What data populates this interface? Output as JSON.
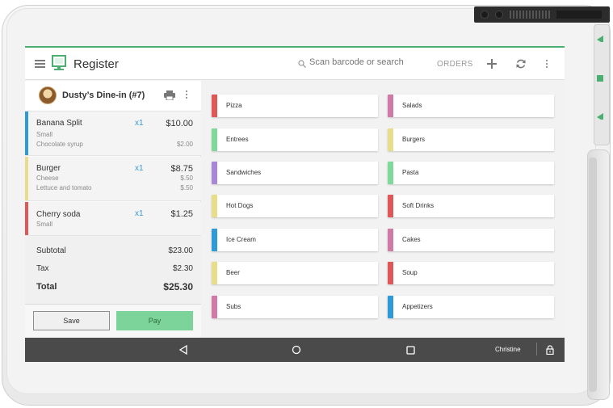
{
  "app": {
    "title": "Register",
    "search_placeholder": "Scan barcode or search",
    "orders_label": "ORDERS",
    "accent_color": "#4caf72"
  },
  "order": {
    "name": "Dusty’s Dine-in (#7)",
    "items": [
      {
        "name": "Banana Split",
        "qty": "x1",
        "price": "$10.00",
        "color": "#2f9bd6",
        "modifiers": [
          {
            "name": "Small",
            "price": ""
          },
          {
            "name": "Chocolate syrup",
            "price": "$2.00"
          }
        ]
      },
      {
        "name": "Burger",
        "qty": "x1",
        "price": "$8.75",
        "color": "#e8dd8a",
        "modifiers": [
          {
            "name": "Cheese",
            "price": "$.50"
          },
          {
            "name": "Lettuce and tomato",
            "price": "$.50"
          }
        ]
      },
      {
        "name": "Cherry soda",
        "qty": "x1",
        "price": "$1.25",
        "color": "#e05757",
        "modifiers": [
          {
            "name": "Small",
            "price": ""
          }
        ]
      }
    ],
    "subtotal_label": "Subtotal",
    "subtotal": "$23.00",
    "tax_label": "Tax",
    "tax": "$2.30",
    "total_label": "Total",
    "total": "$25.30",
    "save_label": "Save",
    "pay_label": "Pay"
  },
  "categories": [
    {
      "label": "Pizza",
      "color": "#e05757"
    },
    {
      "label": "Salads",
      "color": "#d17aa8"
    },
    {
      "label": "Entrees",
      "color": "#7fd99b"
    },
    {
      "label": "Burgers",
      "color": "#e8dd8a"
    },
    {
      "label": "Sandwiches",
      "color": "#a987d6"
    },
    {
      "label": "Pasta",
      "color": "#7fd99b"
    },
    {
      "label": "Hot Dogs",
      "color": "#e8dd8a"
    },
    {
      "label": "Soft Drinks",
      "color": "#e05757"
    },
    {
      "label": "Ice Cream",
      "color": "#2f9bd6"
    },
    {
      "label": "Cakes",
      "color": "#d17aa8"
    },
    {
      "label": "Beer",
      "color": "#e8dd8a"
    },
    {
      "label": "Soup",
      "color": "#e05757"
    },
    {
      "label": "Subs",
      "color": "#d17aa8"
    },
    {
      "label": "Appetizers",
      "color": "#2f9bd6"
    }
  ],
  "navbar": {
    "user": "Christine"
  }
}
